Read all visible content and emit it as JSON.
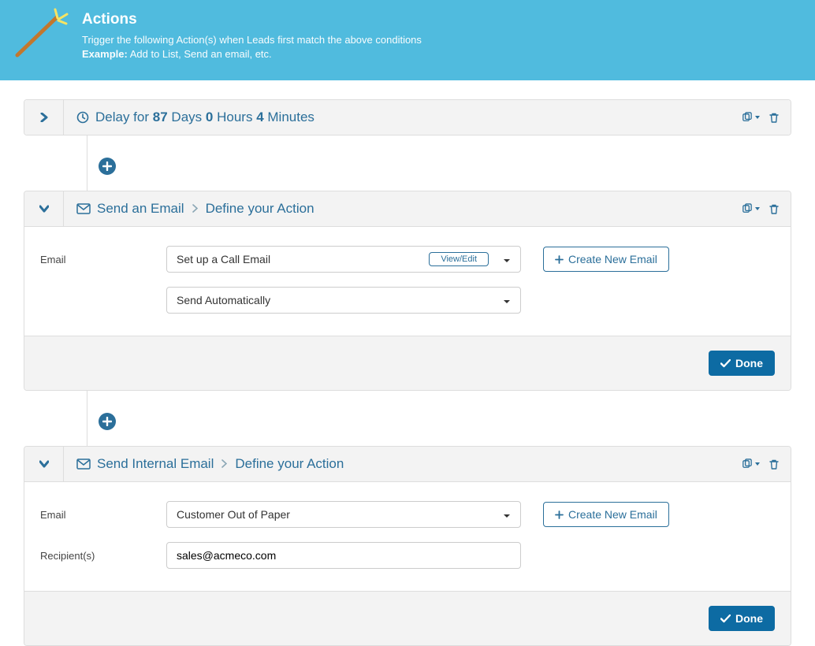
{
  "banner": {
    "title": "Actions",
    "subtitle": "Trigger the following Action(s) when Leads first match the above conditions",
    "example_label": "Example:",
    "example_text": "Add to List, Send an email, etc."
  },
  "delay": {
    "prefix": "Delay for",
    "days": "87",
    "days_unit": "Days",
    "hours": "0",
    "hours_unit": "Hours",
    "minutes": "4",
    "minutes_unit": "Minutes"
  },
  "common": {
    "define_crumb": "Define your Action",
    "done": "Done",
    "create_new_email": "Create New Email",
    "view_edit": "View/Edit"
  },
  "action1": {
    "title": "Send an Email",
    "email_label": "Email",
    "email_template": "Set up a Call Email",
    "send_mode": "Send Automatically"
  },
  "action2": {
    "title": "Send Internal Email",
    "email_label": "Email",
    "email_template": "Customer Out of Paper",
    "recipients_label": "Recipient(s)",
    "recipients_value": "sales@acmeco.com"
  }
}
